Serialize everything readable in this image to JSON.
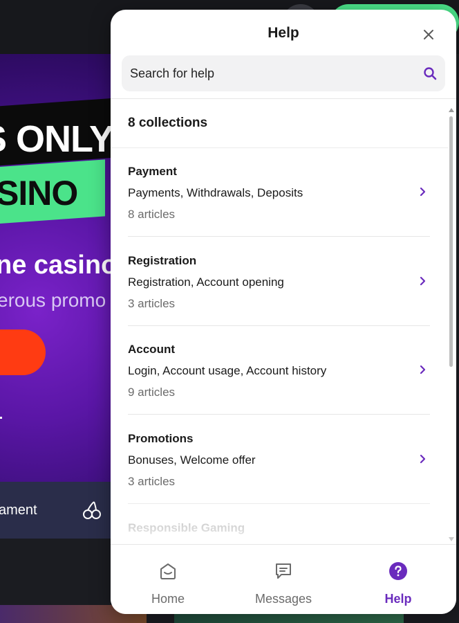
{
  "background": {
    "hero_line1": "S ONLY",
    "hero_line2": "SINO",
    "headline": "ne casino",
    "subline": "erous promo",
    "nav_text": "ament"
  },
  "panel": {
    "title": "Help",
    "search": {
      "placeholder": "Search for help"
    },
    "collections_count": "8 collections",
    "collections": [
      {
        "title": "Payment",
        "description": "Payments, Withdrawals, Deposits",
        "articles": "8 articles"
      },
      {
        "title": "Registration",
        "description": "Registration, Account opening",
        "articles": "3 articles"
      },
      {
        "title": "Account",
        "description": "Login, Account usage, Account history",
        "articles": "9 articles"
      },
      {
        "title": "Promotions",
        "description": "Bonuses, Welcome offer",
        "articles": "3 articles"
      },
      {
        "title": "Responsible Gaming",
        "description": "",
        "articles": ""
      }
    ],
    "nav": [
      {
        "label": "Home",
        "icon": "home-icon",
        "active": false
      },
      {
        "label": "Messages",
        "icon": "messages-icon",
        "active": false
      },
      {
        "label": "Help",
        "icon": "help-icon",
        "active": true
      }
    ]
  },
  "colors": {
    "accent": "#6a2bbd",
    "brand_green": "#4be38a",
    "hero_purple": "#5a16a6",
    "cta_red": "#ff3b12"
  }
}
